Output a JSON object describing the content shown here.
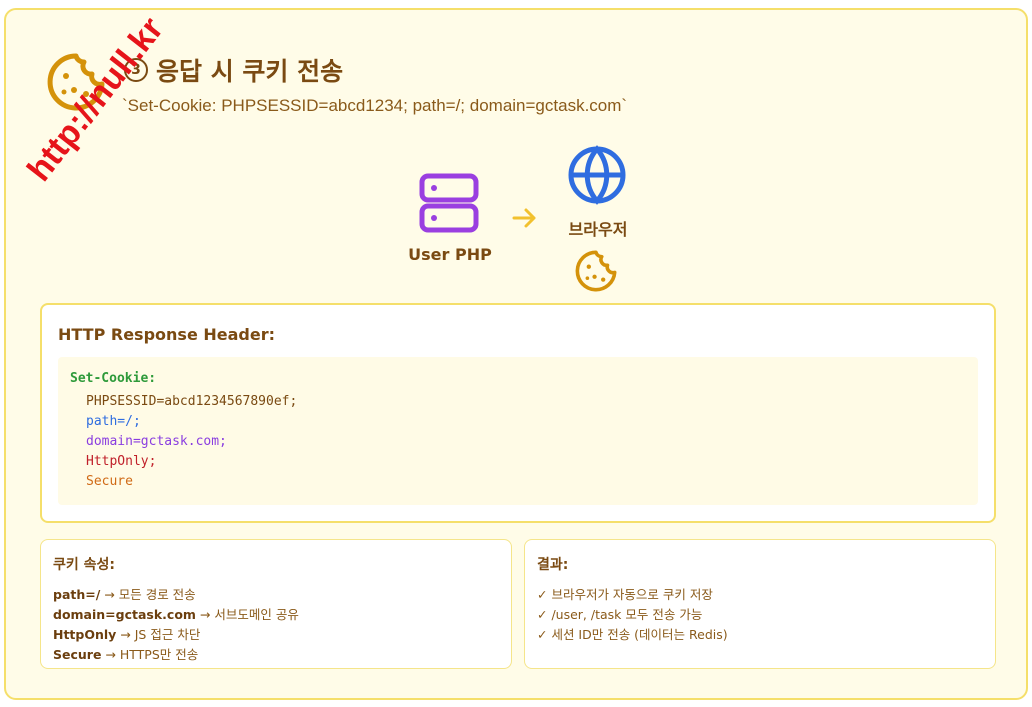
{
  "header": {
    "step_number": "3",
    "title": "응답 시 쿠키 전송",
    "subtitle": "`Set-Cookie: PHPSESSID=abcd1234; path=/; domain=gctask.com`"
  },
  "watermark": "http://null.kr",
  "flow": {
    "server_label": "User PHP",
    "browser_label": "브라우저",
    "icons": [
      "cookie-icon",
      "server-icon",
      "arrow-right-icon",
      "globe-icon",
      "cookie-icon"
    ]
  },
  "response": {
    "title": "HTTP Response Header:",
    "header_name": "Set-Cookie:",
    "lines": [
      "PHPSESSID=abcd1234567890ef;",
      "path=/;",
      "domain=gctask.com;",
      "HttpOnly;",
      "Secure"
    ]
  },
  "attributes": {
    "title": "쿠키 속성:",
    "items": [
      {
        "key": "path=/",
        "desc": " → 모든 경로 전송"
      },
      {
        "key": "domain=gctask.com",
        "desc": " → 서브도메인 공유"
      },
      {
        "key": "HttpOnly",
        "desc": " → JS 접근 차단"
      },
      {
        "key": "Secure",
        "desc": " → HTTPS만 전송"
      }
    ]
  },
  "result": {
    "title": "결과:",
    "items": [
      "✓ 브라우저가 자동으로 쿠키 저장",
      "✓ /user, /task 모두 전송 가능",
      "✓ 세션 ID만 전송 (데이터는 Redis)"
    ]
  },
  "colors": {
    "card_bg": "#fffce8",
    "border": "#f5df6a",
    "text": "#7a4a12",
    "cookie": "#d4920a",
    "server": "#9a3fe0",
    "globe": "#2f6de0",
    "arrow": "#f2c12e"
  }
}
